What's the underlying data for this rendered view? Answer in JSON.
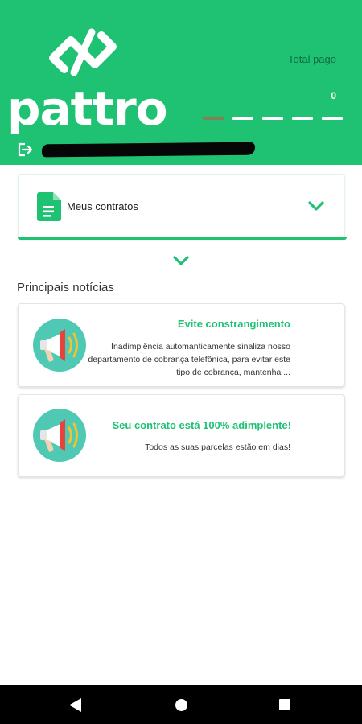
{
  "header": {
    "logo_text": "pattro",
    "total_label": "Total pago",
    "total_value": "0",
    "background_color": "#1fc173"
  },
  "contracts": {
    "label": "Meus contratos",
    "icon": "document-icon",
    "toggle_icon": "chevron-down-icon"
  },
  "news": {
    "section_title": "Principais notícias",
    "items": [
      {
        "icon": "megaphone-icon",
        "title": "Evite constrangimento",
        "body": "Inadimplência automanticamente sinaliza nosso departamento de cobrança telefônica, para evitar este tipo de cobrança, mantenha ..."
      },
      {
        "icon": "megaphone-icon",
        "title": "Seu contrato está 100% adimplente!",
        "body": "Todos as suas parcelas estão em dias!"
      }
    ]
  },
  "navigation": {
    "back": "back-icon",
    "home": "home-icon",
    "recent": "recent-apps-icon"
  },
  "colors": {
    "accent": "#1fc173",
    "navbar": "#000000"
  }
}
